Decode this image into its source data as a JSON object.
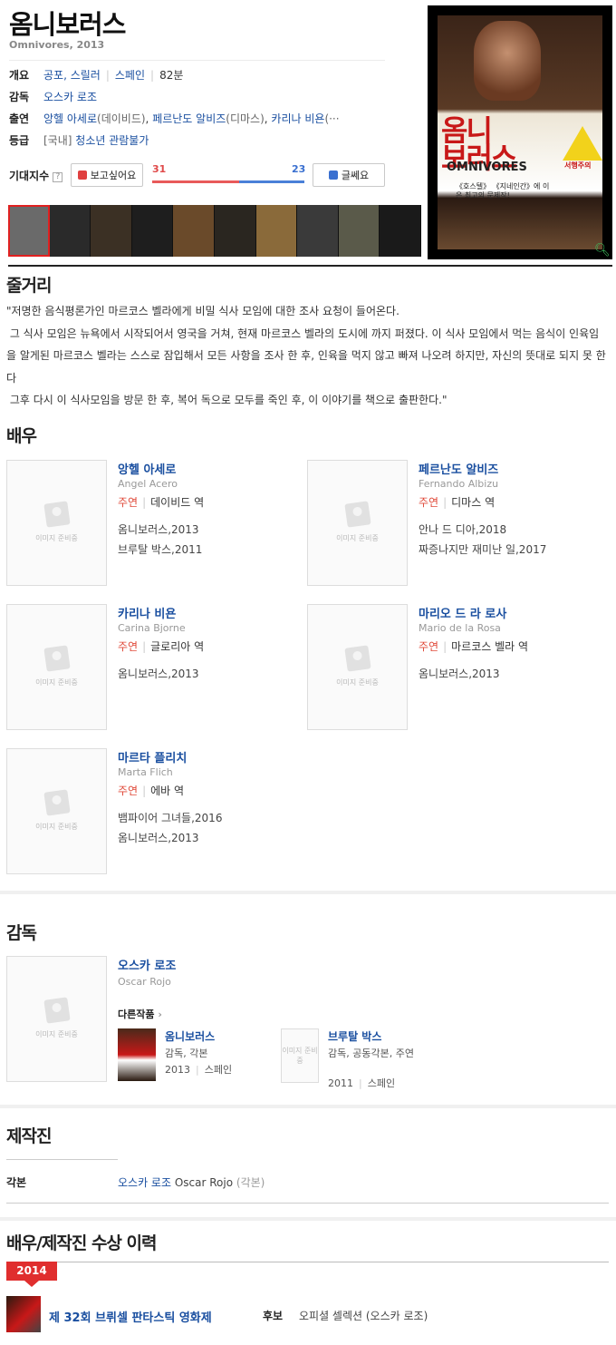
{
  "movie": {
    "title": "옴니보러스",
    "subtitle": "Omnivores, 2013",
    "overview": {
      "label": "개요",
      "genre": "공포, 스릴러",
      "country": "스페인",
      "runtime": "82분"
    },
    "director": {
      "label": "감독",
      "name": "오스카 로조"
    },
    "cast": {
      "label": "출연",
      "text": "앙헬 아세로",
      "role1": "(데이비드)",
      "name2": "페르난도 알비즈",
      "role2": "(디마스)",
      "name3": "카리나 비욘",
      "trail": "(···"
    },
    "rating": {
      "label": "등급",
      "region": "[국내]",
      "value": "청소년 관람불가"
    }
  },
  "expectation": {
    "label": "기대지수",
    "help": "?",
    "want_label": "보고싶어요",
    "want_count": "31",
    "meh_label": "글쎄요",
    "meh_count": "23",
    "want_ratio": 0.574,
    "colors": {
      "want": "#e85a5a",
      "meh": "#4a80d8"
    }
  },
  "stills": [
    {
      "color": "#6a6a6a"
    },
    {
      "color": "#2a2a2a"
    },
    {
      "color": "#3b3024"
    },
    {
      "color": "#1e1e1e"
    },
    {
      "color": "#6a4a2a"
    },
    {
      "color": "#2a2620"
    },
    {
      "color": "#8a6a3a"
    },
    {
      "color": "#3a3a3a"
    },
    {
      "color": "#5a5a4a"
    },
    {
      "color": "#1a1a1a"
    }
  ],
  "poster": {
    "title_line1": "옴니",
    "title_line2": "보러스",
    "en": "OMNIVORES",
    "tagline": "《호스텔》 《지네인간》에 이은 최고의 문제작!",
    "warning": "서행주의",
    "search_icon": "magnifier-icon"
  },
  "synopsis": {
    "heading": "줄거리",
    "text": "\"저명한 음식평론가인 마르코스 벨라에게 비밀 식사 모임에 대한 조사 요청이 들어온다.\n 그 식사 모임은 뉴욕에서 시작되어서 영국을 거쳐, 현재 마르코스 벨라의 도시에 까지 퍼졌다. 이 식사 모임에서 먹는 음식이 인육임을 알게된 마르코스 벨라는 스스로 잠입해서 모든 사항을 조사 한 후, 인육을 먹지 않고 빠져 나오려 하지만, 자신의 뜻대로 되지 못 한다\n 그후 다시 이 식사모임을 방문 한 후, 복어 독으로 모두를 죽인 후, 이 이야기를 책으로 출판한다.\""
  },
  "placeholder_text": "이미지 준비중",
  "actors": {
    "heading": "배우",
    "items": [
      {
        "name": "앙헬 아세로",
        "en": "Angel Acero",
        "type": "주연",
        "role": "데이비드 역",
        "films": [
          "옴니보러스,2013",
          "브루탈 박스,2011"
        ]
      },
      {
        "name": "페르난도 알비즈",
        "en": "Fernando Albizu",
        "type": "주연",
        "role": "디마스 역",
        "films": [
          "안나 드 디아,2018",
          "짜증나지만 재미난 일,2017"
        ]
      },
      {
        "name": "카리나 비욘",
        "en": "Carina Bjorne",
        "type": "주연",
        "role": "글로리아 역",
        "films": [
          "옴니보러스,2013"
        ]
      },
      {
        "name": "마리오 드 라 로사",
        "en": "Mario de la Rosa",
        "type": "주연",
        "role": "마르코스 벨라 역",
        "films": [
          "옴니보러스,2013"
        ]
      },
      {
        "name": "마르타 플리치",
        "en": "Marta Flich",
        "type": "주연",
        "role": "에바 역",
        "films": [
          "뱀파이어 그녀들,2016",
          "옴니보러스,2013"
        ]
      }
    ]
  },
  "director_section": {
    "heading": "감독",
    "name": "오스카 로조",
    "en": "Oscar Rojo",
    "other_works_label": "다른작품",
    "works": [
      {
        "title": "옴니보러스",
        "role": "감독, 각본",
        "year": "2013",
        "country": "스페인"
      },
      {
        "title": "브루탈 박스",
        "role": "감독, 공동각본, 주연",
        "year": "2011",
        "country": "스페인"
      }
    ],
    "mini_placeholder": "이미지 준비중"
  },
  "crew": {
    "heading": "제작진",
    "label": "각본",
    "name": "오스카 로조",
    "en": "Oscar Rojo",
    "role": "(각본)"
  },
  "awards": {
    "heading": "배우/제작진 수상 이력",
    "year": "2014",
    "festival": "제 32회 브뤼셀 판타스틱 영화제",
    "kind": "후보",
    "detail": "오피셜 셀렉션 (오스카 로조)"
  }
}
